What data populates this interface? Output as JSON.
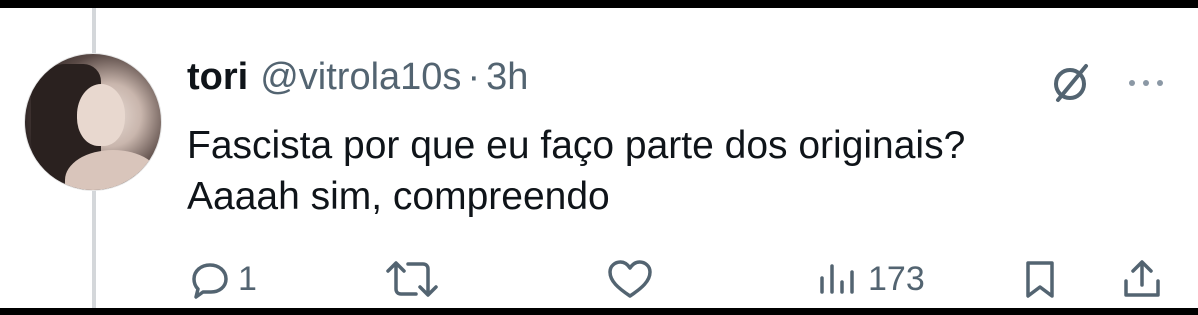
{
  "tweet": {
    "display_name": "tori",
    "handle": "@vitrola10s",
    "separator": "·",
    "time": "3h",
    "text_lines": [
      "Fascista por que eu faço parte dos originais?",
      "Aaaah sim, compreendo"
    ]
  },
  "actions": {
    "reply_count": "1",
    "views_count": "173"
  },
  "icons": {
    "grok": "grok-icon",
    "more": "more-icon",
    "reply": "reply-icon",
    "retweet": "retweet-icon",
    "like": "heart-icon",
    "views": "views-icon",
    "bookmark": "bookmark-icon",
    "share": "share-icon"
  },
  "colors": {
    "text": "#0f1419",
    "secondary": "#536471",
    "thread_line": "#d4d7da"
  }
}
